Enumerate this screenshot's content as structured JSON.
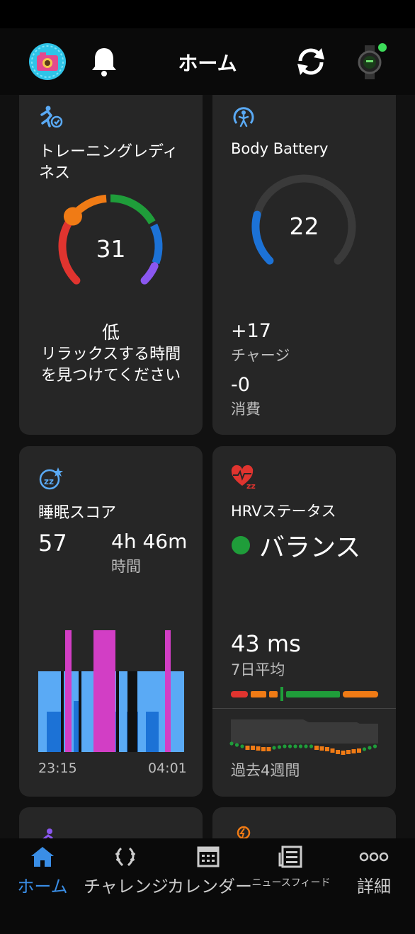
{
  "header": {
    "title": "ホーム"
  },
  "training_readiness": {
    "title_line1": "トレーニングレディ",
    "title_line2": "ネス",
    "value": "31",
    "level": "低",
    "message_line1": "リラックスする時間",
    "message_line2": "を見つけてください",
    "colors": {
      "red": "#e0342f",
      "orange": "#f07b15",
      "green": "#1f9d3a",
      "blue": "#1c72d6",
      "purple": "#8a57f0"
    }
  },
  "body_battery": {
    "title": "Body Battery",
    "value": "22",
    "fill_fraction": 0.22,
    "charge_value": "+17",
    "charge_label": "チャージ",
    "drain_value": "-0",
    "drain_label": "消費",
    "colors": {
      "fill": "#1c72d6",
      "track": "#3a3a3a"
    }
  },
  "sleep": {
    "title": "睡眠スコア",
    "score": "57",
    "duration": "4h 46m",
    "duration_label": "時間",
    "start_time": "23:15",
    "end_time": "04:01",
    "colors": {
      "light": "#5aaaf5",
      "deep": "#1c72d6",
      "rem": "#d23ec5"
    }
  },
  "hrv": {
    "title": "HRVステータス",
    "status": "バランス",
    "average_value": "43 ms",
    "average_label": "7日平均",
    "period_label": "過去4週間",
    "colors": {
      "status": "#1f9d3a",
      "red": "#e0342f",
      "orange": "#f07b15",
      "green": "#1f9d3a"
    }
  },
  "nav": {
    "home": "ホーム",
    "challenges": "チャレンジ",
    "calendar": "カレンダー",
    "news": "ニュースフィード",
    "more": "詳細",
    "colors": {
      "active": "#3a8ee6",
      "inactive": "#cccccc"
    }
  }
}
